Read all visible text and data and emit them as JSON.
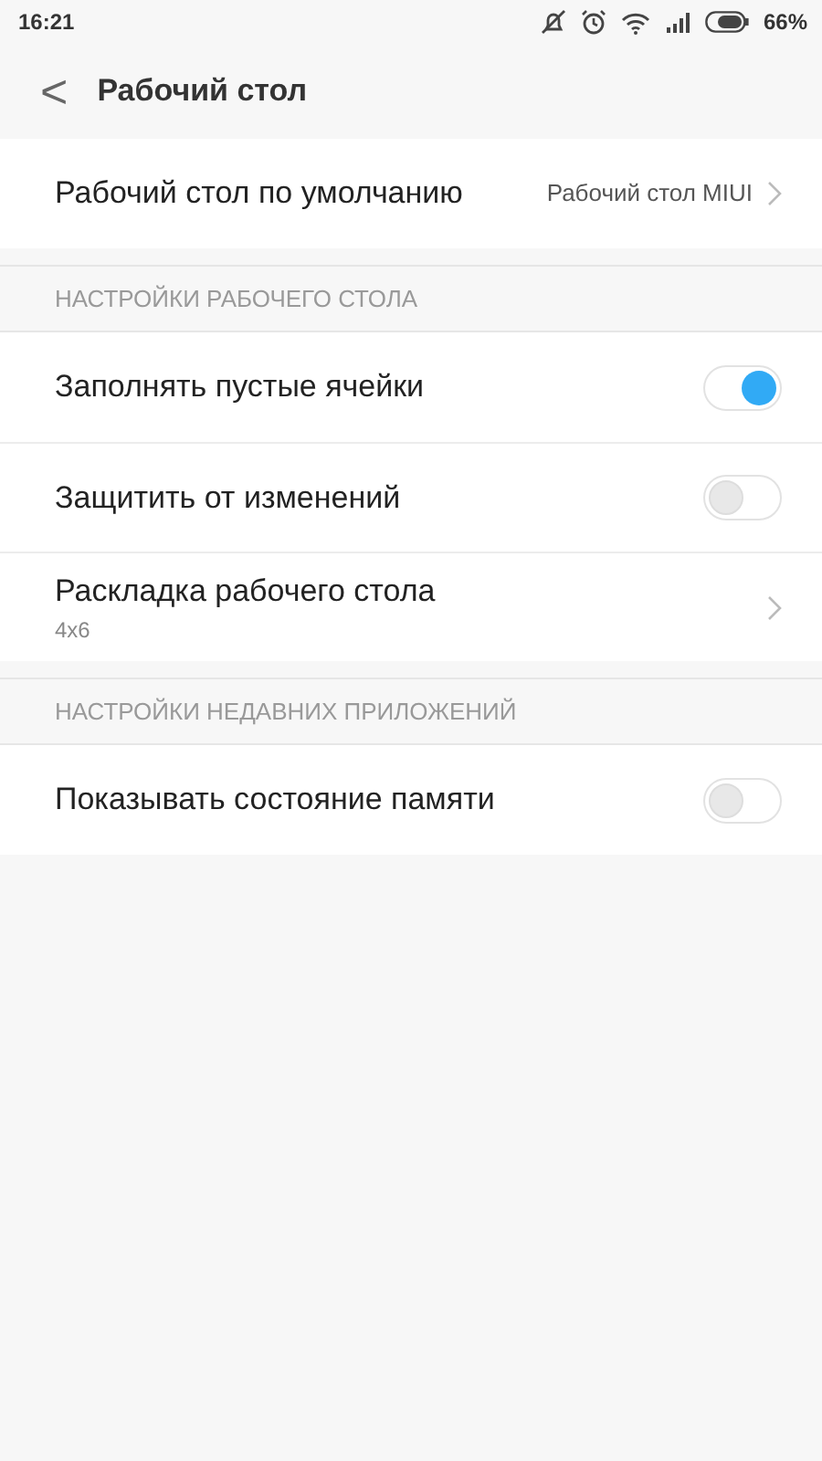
{
  "status_bar": {
    "time": "16:21",
    "battery": "66%"
  },
  "header": {
    "back": "<",
    "title": "Рабочий стол"
  },
  "sections": [
    {
      "items": [
        {
          "kind": "link",
          "label": "Рабочий стол по умолчанию",
          "value": "Рабочий стол MIUI"
        }
      ]
    },
    {
      "title": "НАСТРОЙКИ РАБОЧЕГО СТОЛА",
      "items": [
        {
          "kind": "toggle",
          "label": "Заполнять пустые ячейки",
          "on": true
        },
        {
          "kind": "toggle",
          "label": "Защитить от изменений",
          "on": false
        },
        {
          "kind": "link",
          "label": "Раскладка рабочего стола",
          "subtitle": "4x6"
        }
      ]
    },
    {
      "title": "НАСТРОЙКИ НЕДАВНИХ ПРИЛОЖЕНИЙ",
      "items": [
        {
          "kind": "toggle",
          "label": "Показывать состояние памяти",
          "on": false
        }
      ]
    }
  ]
}
